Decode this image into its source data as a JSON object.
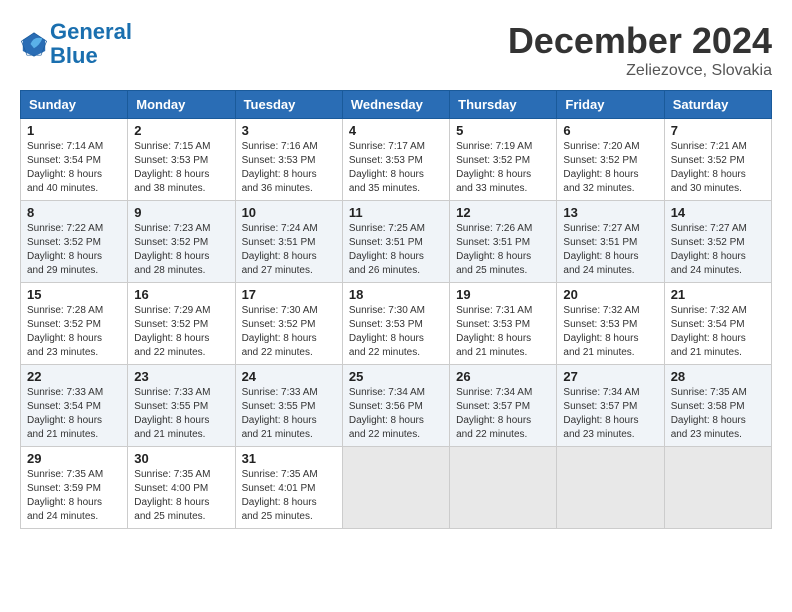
{
  "logo": {
    "line1": "General",
    "line2": "Blue"
  },
  "title": "December 2024",
  "location": "Zeliezovce, Slovakia",
  "weekdays": [
    "Sunday",
    "Monday",
    "Tuesday",
    "Wednesday",
    "Thursday",
    "Friday",
    "Saturday"
  ],
  "weeks": [
    [
      {
        "day": "1",
        "info": "Sunrise: 7:14 AM\nSunset: 3:54 PM\nDaylight: 8 hours\nand 40 minutes."
      },
      {
        "day": "2",
        "info": "Sunrise: 7:15 AM\nSunset: 3:53 PM\nDaylight: 8 hours\nand 38 minutes."
      },
      {
        "day": "3",
        "info": "Sunrise: 7:16 AM\nSunset: 3:53 PM\nDaylight: 8 hours\nand 36 minutes."
      },
      {
        "day": "4",
        "info": "Sunrise: 7:17 AM\nSunset: 3:53 PM\nDaylight: 8 hours\nand 35 minutes."
      },
      {
        "day": "5",
        "info": "Sunrise: 7:19 AM\nSunset: 3:52 PM\nDaylight: 8 hours\nand 33 minutes."
      },
      {
        "day": "6",
        "info": "Sunrise: 7:20 AM\nSunset: 3:52 PM\nDaylight: 8 hours\nand 32 minutes."
      },
      {
        "day": "7",
        "info": "Sunrise: 7:21 AM\nSunset: 3:52 PM\nDaylight: 8 hours\nand 30 minutes."
      }
    ],
    [
      {
        "day": "8",
        "info": "Sunrise: 7:22 AM\nSunset: 3:52 PM\nDaylight: 8 hours\nand 29 minutes."
      },
      {
        "day": "9",
        "info": "Sunrise: 7:23 AM\nSunset: 3:52 PM\nDaylight: 8 hours\nand 28 minutes."
      },
      {
        "day": "10",
        "info": "Sunrise: 7:24 AM\nSunset: 3:51 PM\nDaylight: 8 hours\nand 27 minutes."
      },
      {
        "day": "11",
        "info": "Sunrise: 7:25 AM\nSunset: 3:51 PM\nDaylight: 8 hours\nand 26 minutes."
      },
      {
        "day": "12",
        "info": "Sunrise: 7:26 AM\nSunset: 3:51 PM\nDaylight: 8 hours\nand 25 minutes."
      },
      {
        "day": "13",
        "info": "Sunrise: 7:27 AM\nSunset: 3:51 PM\nDaylight: 8 hours\nand 24 minutes."
      },
      {
        "day": "14",
        "info": "Sunrise: 7:27 AM\nSunset: 3:52 PM\nDaylight: 8 hours\nand 24 minutes."
      }
    ],
    [
      {
        "day": "15",
        "info": "Sunrise: 7:28 AM\nSunset: 3:52 PM\nDaylight: 8 hours\nand 23 minutes."
      },
      {
        "day": "16",
        "info": "Sunrise: 7:29 AM\nSunset: 3:52 PM\nDaylight: 8 hours\nand 22 minutes."
      },
      {
        "day": "17",
        "info": "Sunrise: 7:30 AM\nSunset: 3:52 PM\nDaylight: 8 hours\nand 22 minutes."
      },
      {
        "day": "18",
        "info": "Sunrise: 7:30 AM\nSunset: 3:53 PM\nDaylight: 8 hours\nand 22 minutes."
      },
      {
        "day": "19",
        "info": "Sunrise: 7:31 AM\nSunset: 3:53 PM\nDaylight: 8 hours\nand 21 minutes."
      },
      {
        "day": "20",
        "info": "Sunrise: 7:32 AM\nSunset: 3:53 PM\nDaylight: 8 hours\nand 21 minutes."
      },
      {
        "day": "21",
        "info": "Sunrise: 7:32 AM\nSunset: 3:54 PM\nDaylight: 8 hours\nand 21 minutes."
      }
    ],
    [
      {
        "day": "22",
        "info": "Sunrise: 7:33 AM\nSunset: 3:54 PM\nDaylight: 8 hours\nand 21 minutes."
      },
      {
        "day": "23",
        "info": "Sunrise: 7:33 AM\nSunset: 3:55 PM\nDaylight: 8 hours\nand 21 minutes."
      },
      {
        "day": "24",
        "info": "Sunrise: 7:33 AM\nSunset: 3:55 PM\nDaylight: 8 hours\nand 21 minutes."
      },
      {
        "day": "25",
        "info": "Sunrise: 7:34 AM\nSunset: 3:56 PM\nDaylight: 8 hours\nand 22 minutes."
      },
      {
        "day": "26",
        "info": "Sunrise: 7:34 AM\nSunset: 3:57 PM\nDaylight: 8 hours\nand 22 minutes."
      },
      {
        "day": "27",
        "info": "Sunrise: 7:34 AM\nSunset: 3:57 PM\nDaylight: 8 hours\nand 23 minutes."
      },
      {
        "day": "28",
        "info": "Sunrise: 7:35 AM\nSunset: 3:58 PM\nDaylight: 8 hours\nand 23 minutes."
      }
    ],
    [
      {
        "day": "29",
        "info": "Sunrise: 7:35 AM\nSunset: 3:59 PM\nDaylight: 8 hours\nand 24 minutes."
      },
      {
        "day": "30",
        "info": "Sunrise: 7:35 AM\nSunset: 4:00 PM\nDaylight: 8 hours\nand 25 minutes."
      },
      {
        "day": "31",
        "info": "Sunrise: 7:35 AM\nSunset: 4:01 PM\nDaylight: 8 hours\nand 25 minutes."
      },
      null,
      null,
      null,
      null
    ]
  ]
}
